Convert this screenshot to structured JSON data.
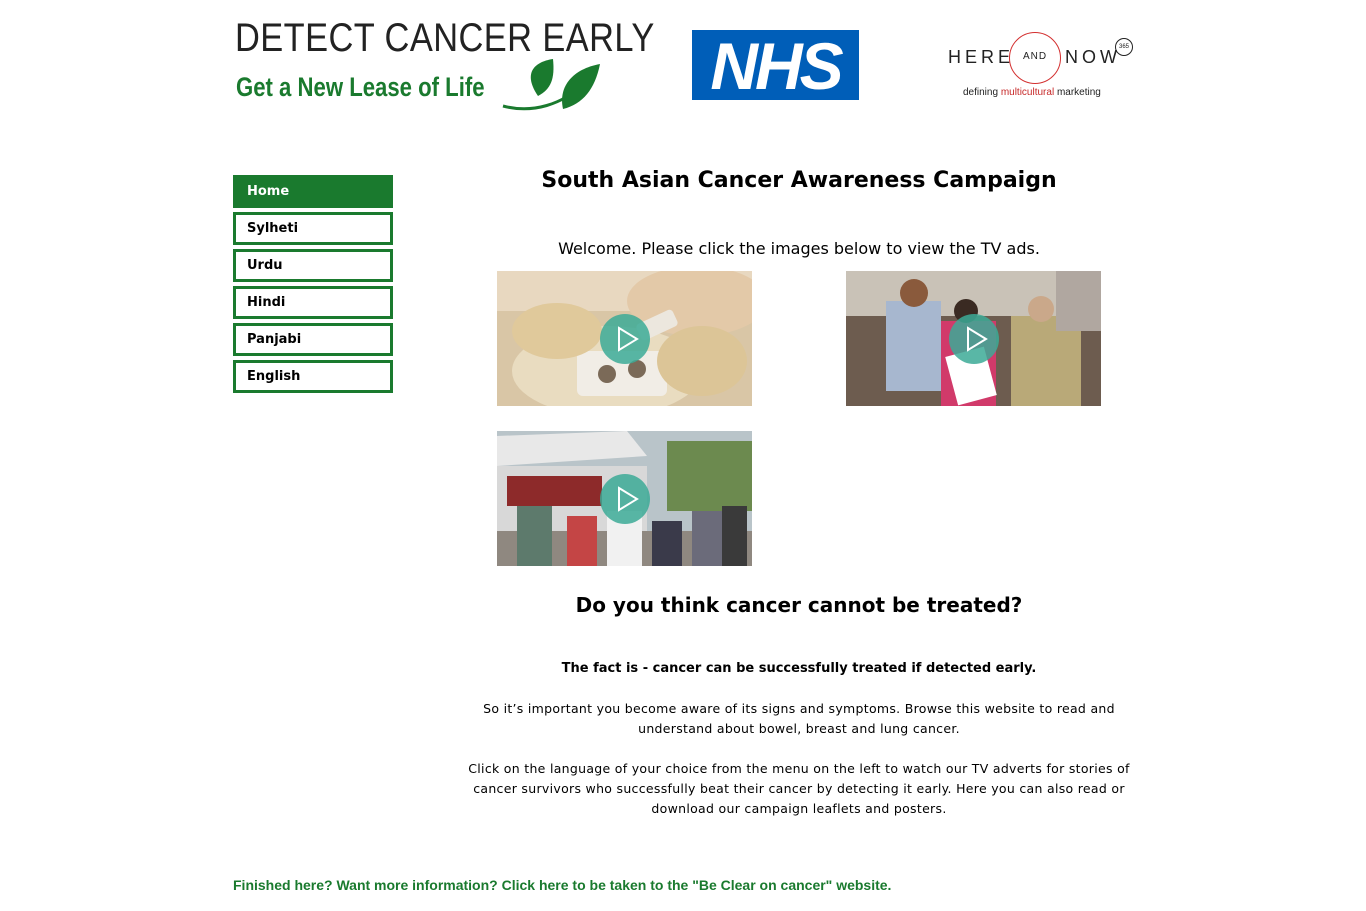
{
  "header": {
    "dce_logo": {
      "line1": "DETECT CANCER EARLY",
      "line2": "Get a New Lease of Life",
      "color": "#1a7a2e"
    },
    "nhs_logo": {
      "text": "NHS",
      "color": "#005eb8"
    },
    "hn_logo": {
      "here": "HERE",
      "and": "AND",
      "now": "NOW",
      "badge": "365",
      "tag_pre": "defining ",
      "tag_mid": "multicultural",
      "tag_post": " marketing"
    }
  },
  "nav": {
    "items": [
      {
        "label": "Home",
        "active": true
      },
      {
        "label": "Sylheti",
        "active": false
      },
      {
        "label": "Urdu",
        "active": false
      },
      {
        "label": "Hindi",
        "active": false
      },
      {
        "label": "Panjabi",
        "active": false
      },
      {
        "label": "English",
        "active": false
      }
    ]
  },
  "main": {
    "title": "South Asian Cancer Awareness Campaign",
    "welcome": "Welcome. Please click the images below to view the TV ads.",
    "videos": [
      {
        "icon": "play-icon"
      },
      {
        "icon": "play-icon"
      },
      {
        "icon": "play-icon"
      }
    ],
    "question": "Do you think cancer cannot be treated?",
    "fact": "The fact is - cancer can be successfully treated if detected early.",
    "para1": "So it’s important you become aware of its signs and symptoms. Browse this website to read and understand about bowel, breast and lung cancer.",
    "para2": "Click on the language of your choice from the menu on the left to watch our TV adverts for stories of cancer survivors who successfully beat their cancer by detecting it early. Here you can also read or download our campaign leaflets and posters."
  },
  "footer": {
    "link": "Finished here? Want more information? Click here to be taken to the \"Be Clear on cancer\" website."
  }
}
